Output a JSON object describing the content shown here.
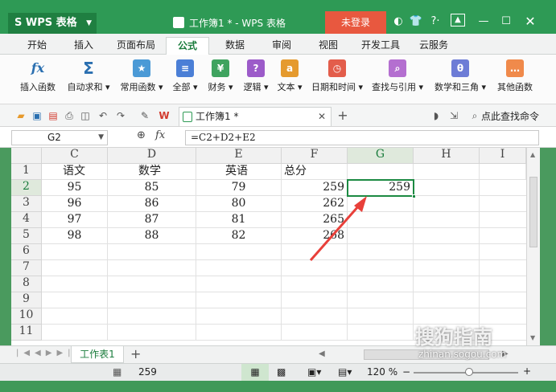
{
  "app": {
    "app_name": "WPS 表格",
    "doc_title": "工作簿1 * - WPS 表格",
    "login_label": "未登录"
  },
  "menu_tabs": [
    "开始",
    "插入",
    "页面布局",
    "公式",
    "数据",
    "审阅",
    "视图",
    "开发工具",
    "云服务"
  ],
  "active_tab": "公式",
  "ribbon": [
    {
      "label": "插入函数",
      "icon": "fx-icon"
    },
    {
      "label": "自动求和",
      "icon": "sigma-icon"
    },
    {
      "label": "常用函数",
      "icon": "star-function-icon"
    },
    {
      "label": "全部",
      "icon": "list-function-icon"
    },
    {
      "label": "财务",
      "icon": "finance-icon"
    },
    {
      "label": "逻辑",
      "icon": "logic-icon"
    },
    {
      "label": "文本",
      "icon": "text-function-icon"
    },
    {
      "label": "日期和时间",
      "icon": "clock-icon"
    },
    {
      "label": "查找与引用",
      "icon": "lookup-icon"
    },
    {
      "label": "数学和三角",
      "icon": "math-icon"
    },
    {
      "label": "其他函数",
      "icon": "more-functions-icon"
    }
  ],
  "qat": {
    "file_tab_label": "工作簿1 *",
    "search_label": "点此查找命令"
  },
  "formula_bar": {
    "name_box": "G2",
    "fx_label": "fx",
    "formula": "=C2+D2+E2"
  },
  "columns": [
    "C",
    "D",
    "E",
    "F",
    "G",
    "H",
    "I"
  ],
  "rows": [
    "1",
    "2",
    "3",
    "4",
    "5",
    "6",
    "7",
    "8",
    "9",
    "10",
    "11"
  ],
  "cells": {
    "r1": [
      "语文",
      "数学",
      "英语",
      "总分",
      "",
      "",
      ""
    ],
    "r2": [
      "95",
      "85",
      "79",
      "259",
      "259",
      "",
      ""
    ],
    "r3": [
      "96",
      "86",
      "80",
      "262",
      "",
      "",
      ""
    ],
    "r4": [
      "97",
      "87",
      "81",
      "265",
      "",
      "",
      ""
    ],
    "r5": [
      "98",
      "88",
      "82",
      "268",
      "",
      "",
      ""
    ]
  },
  "selected_cell": "G2",
  "sheet_tab": "工作表1",
  "status": {
    "sum_value": "259",
    "zoom": "120 %"
  },
  "watermark": {
    "text": "搜狗指南",
    "url": "zhinan.sogou.com"
  },
  "colors": {
    "title_bar": "#2e9a55",
    "login_button": "#e8583f",
    "selection": "#1c8a42",
    "arrow": "#e8403a"
  }
}
